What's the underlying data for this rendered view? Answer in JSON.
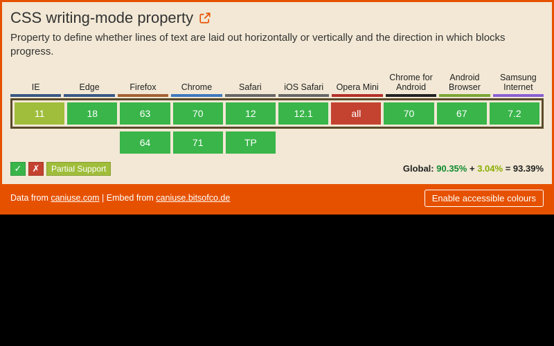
{
  "title": "CSS writing-mode property",
  "description": "Property to define whether lines of text are laid out horizontally or vertically and the direction in which blocks progress.",
  "browsers": [
    {
      "name": "IE",
      "bar": "#385884",
      "current": {
        "label": "11",
        "status": "partial"
      },
      "next": null
    },
    {
      "name": "Edge",
      "bar": "#385884",
      "current": {
        "label": "18",
        "status": "supported"
      },
      "next": null
    },
    {
      "name": "Firefox",
      "bar": "#a36133",
      "current": {
        "label": "63",
        "status": "supported"
      },
      "next": {
        "label": "64",
        "status": "supported"
      }
    },
    {
      "name": "Chrome",
      "bar": "#3f77bd",
      "current": {
        "label": "70",
        "status": "supported"
      },
      "next": {
        "label": "71",
        "status": "supported"
      }
    },
    {
      "name": "Safari",
      "bar": "#666666",
      "current": {
        "label": "12",
        "status": "supported"
      },
      "next": {
        "label": "TP",
        "status": "supported"
      }
    },
    {
      "name": "iOS Safari",
      "bar": "#666666",
      "current": {
        "label": "12.1",
        "status": "supported"
      },
      "next": null
    },
    {
      "name": "Opera Mini",
      "bar": "#b23028",
      "current": {
        "label": "all",
        "status": "unsupported"
      },
      "next": null
    },
    {
      "name": "Chrome for Android",
      "bar": "#222222",
      "current": {
        "label": "70",
        "status": "supported"
      },
      "next": null
    },
    {
      "name": "Android Browser",
      "bar": "#7aa634",
      "current": {
        "label": "67",
        "status": "supported"
      },
      "next": null
    },
    {
      "name": "Samsung Internet",
      "bar": "#8a5fd3",
      "current": {
        "label": "7.2",
        "status": "supported"
      },
      "next": null
    }
  ],
  "legend": {
    "supported_symbol": "✓",
    "unsupported_symbol": "✗",
    "partial_label": "Partial Support"
  },
  "global": {
    "label": "Global:",
    "supported_pct": "90.35%",
    "plus": "+",
    "partial_pct": "3.04%",
    "equals": "=",
    "total_pct": "93.39%"
  },
  "footer": {
    "prefix": "Data from ",
    "link1": "caniuse.com",
    "mid": " | Embed from ",
    "link2": "caniuse.bitsofco.de",
    "button": "Enable accessible colours"
  }
}
